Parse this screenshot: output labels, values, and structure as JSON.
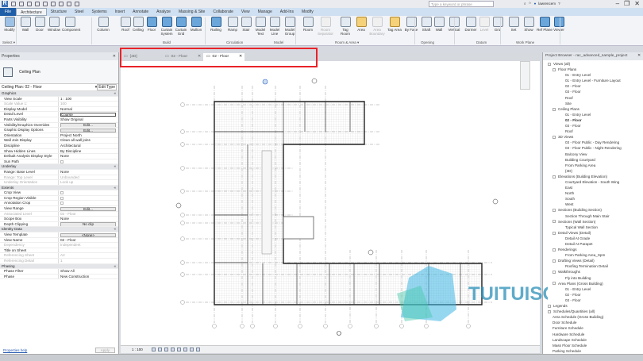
{
  "quick_access": {
    "search_placeholder": "Type a keyword or phrase",
    "user": "lawrencem"
  },
  "ribbon": {
    "tabs": [
      "File",
      "Architecture",
      "Structure",
      "Steel",
      "Systems",
      "Insert",
      "Annotate",
      "Analyze",
      "Massing & Site",
      "Collaborate",
      "View",
      "Manage",
      "Add-Ins",
      "Modify"
    ],
    "active_tab": "Architecture",
    "tools": [
      "Modify",
      "Wall",
      "Door",
      "Window",
      "Component",
      "Column",
      "Roof",
      "Ceiling",
      "Floor",
      "Curtain System",
      "Curtain Grid",
      "Mullion",
      "Railing",
      "Ramp",
      "Stair",
      "Model Text",
      "Model Line",
      "Model Group",
      "Room",
      "Room Separator",
      "Tag Room",
      "Area",
      "Area Boundary",
      "Tag Area",
      "By Face",
      "Shaft",
      "Wall",
      "Vertical",
      "Dormer",
      "Level",
      "Grid",
      "Set",
      "Show",
      "Ref Plane",
      "Viewer"
    ],
    "panels": [
      "Select ▾",
      "Build",
      "Circulation",
      "Model",
      "Room & Area ▾",
      "Opening",
      "Datum",
      "Work Plane"
    ]
  },
  "properties": {
    "title": "Properties",
    "type_name": "Ceiling Plan",
    "instance": "Ceiling Plan: 02 - Floor",
    "edit_type": "Edit Type",
    "rows": [
      {
        "g": "Graphics"
      },
      {
        "k": "View Scale",
        "v": "1 : 100"
      },
      {
        "k": "Scale Value    1:",
        "v": "100",
        "dim": true
      },
      {
        "k": "Display Model",
        "v": "Normal"
      },
      {
        "k": "Detail Level",
        "v": "Coarse",
        "box": true
      },
      {
        "k": "Parts Visibility",
        "v": "Show Original"
      },
      {
        "k": "Visibility/Graphics Overrides",
        "v": "Edit...",
        "btn": true
      },
      {
        "k": "Graphic Display Options",
        "v": "Edit...",
        "btn": true
      },
      {
        "k": "Orientation",
        "v": "Project North"
      },
      {
        "k": "Wall Join Display",
        "v": "Clean all wall joins"
      },
      {
        "k": "Discipline",
        "v": "Architectural"
      },
      {
        "k": "Show Hidden Lines",
        "v": "By Discipline"
      },
      {
        "k": "Default Analysis Display Style",
        "v": "None"
      },
      {
        "k": "Sun Path",
        "chk": true
      },
      {
        "g": "Underlay"
      },
      {
        "k": "Range: Base Level",
        "v": "None"
      },
      {
        "k": "Range: Top Level",
        "v": "Unbounded",
        "dim": true
      },
      {
        "k": "Underlay Orientation",
        "v": "Look up",
        "dim": true
      },
      {
        "g": "Extents"
      },
      {
        "k": "Crop View",
        "chk": true
      },
      {
        "k": "Crop Region Visible",
        "chk": true
      },
      {
        "k": "Annotation Crop",
        "chk": true
      },
      {
        "k": "View Range",
        "v": "Edit...",
        "btn": true
      },
      {
        "k": "Associated Level",
        "v": "02 - Floor",
        "dim": true
      },
      {
        "k": "Scope Box",
        "v": "None"
      },
      {
        "k": "Depth Clipping",
        "v": "No clip",
        "btn": true
      },
      {
        "g": "Identity Data"
      },
      {
        "k": "View Template",
        "v": "<None>",
        "btn": true
      },
      {
        "k": "View Name",
        "v": "02 - Floor"
      },
      {
        "k": "Dependency",
        "v": "Independent",
        "dim": true
      },
      {
        "k": "Title on Sheet",
        "v": ""
      },
      {
        "k": "Referencing Sheet",
        "v": "A2",
        "dim": true
      },
      {
        "k": "Referencing Detail",
        "v": "1",
        "dim": true
      },
      {
        "g": "Phasing"
      },
      {
        "k": "Phase Filter",
        "v": "Show All"
      },
      {
        "k": "Phase",
        "v": "New Construction"
      }
    ],
    "help": "Properties help",
    "apply": "Apply"
  },
  "view_tabs": [
    {
      "label": "{3D}"
    },
    {
      "label": "02 - Floor"
    },
    {
      "label": "02 - Floor",
      "active": true
    }
  ],
  "view_status": {
    "scale": "1 : 100"
  },
  "browser": {
    "title": "Project Browser - rac_advanced_sample_project",
    "items": [
      {
        "t": "Views (all)",
        "l": 0,
        "pm": true
      },
      {
        "t": "Floor Plans",
        "l": 1,
        "pm": true
      },
      {
        "t": "01 - Entry Level",
        "l": 2
      },
      {
        "t": "01 - Entry Level - Furniture Layout",
        "l": 2
      },
      {
        "t": "02 - Floor",
        "l": 2
      },
      {
        "t": "03 - Floor",
        "l": 2
      },
      {
        "t": "Roof",
        "l": 2
      },
      {
        "t": "Site",
        "l": 2
      },
      {
        "t": "Ceiling Plans",
        "l": 1,
        "pm": true
      },
      {
        "t": "01 - Entry Level",
        "l": 2
      },
      {
        "t": "02 - Floor",
        "l": 2,
        "bold": true
      },
      {
        "t": "03 - Floor",
        "l": 2
      },
      {
        "t": "Roof",
        "l": 2
      },
      {
        "t": "3D Views",
        "l": 1,
        "pm": true
      },
      {
        "t": "03 - Floor Public - Day Rendering",
        "l": 2
      },
      {
        "t": "03 - Floor Public - Night Rendering",
        "l": 2
      },
      {
        "t": "Balcony View",
        "l": 2
      },
      {
        "t": "Building Courtyard",
        "l": 2
      },
      {
        "t": "From Parking Area",
        "l": 2
      },
      {
        "t": "{3D}",
        "l": 2
      },
      {
        "t": "Elevations (Building Elevation)",
        "l": 1,
        "pm": true
      },
      {
        "t": "Courtyard Elevation - South Wing",
        "l": 2
      },
      {
        "t": "East",
        "l": 2
      },
      {
        "t": "North",
        "l": 2
      },
      {
        "t": "South",
        "l": 2
      },
      {
        "t": "West",
        "l": 2
      },
      {
        "t": "Sections (Building Section)",
        "l": 1,
        "pm": true
      },
      {
        "t": "Section Through Main Stair",
        "l": 2
      },
      {
        "t": "Sections (Wall Section)",
        "l": 1,
        "pm": true
      },
      {
        "t": "Typical Wall Section",
        "l": 2
      },
      {
        "t": "Detail Views (Detail)",
        "l": 1,
        "pm": true
      },
      {
        "t": "Detail At Grade",
        "l": 2
      },
      {
        "t": "Detail At Parapet",
        "l": 2
      },
      {
        "t": "Renderings",
        "l": 1,
        "pm": true
      },
      {
        "t": "From Parking Area_Spm",
        "l": 2
      },
      {
        "t": "Drafting Views (Detail)",
        "l": 1,
        "pm": true
      },
      {
        "t": "Roofing Termination Detail",
        "l": 2
      },
      {
        "t": "Walkthroughs",
        "l": 1,
        "pm": true
      },
      {
        "t": "Fly into Building",
        "l": 2
      },
      {
        "t": "Area Plans (Gross Building)",
        "l": 1,
        "pm": true
      },
      {
        "t": "01 - Entry Level",
        "l": 2
      },
      {
        "t": "02 - Floor",
        "l": 2
      },
      {
        "t": "03 - Floor",
        "l": 2
      },
      {
        "t": "Legends",
        "l": 0,
        "pm": true
      },
      {
        "t": "Schedules/Quantities (all)",
        "l": 0,
        "pm": true
      },
      {
        "t": "Area Schedule (Gross Building)",
        "l": 1
      },
      {
        "t": "Door Schedule",
        "l": 1
      },
      {
        "t": "Furniture Schedule",
        "l": 1
      },
      {
        "t": "Hardware Schedule",
        "l": 1
      },
      {
        "t": "Landscape Schedule",
        "l": 1
      },
      {
        "t": "Mass Floor Schedule",
        "l": 1
      },
      {
        "t": "Parking Schedule",
        "l": 1
      }
    ]
  },
  "watermark": "TUITUISOFT",
  "colors": {
    "accent": "#1e5ea8",
    "highlight": "#e8232a"
  }
}
